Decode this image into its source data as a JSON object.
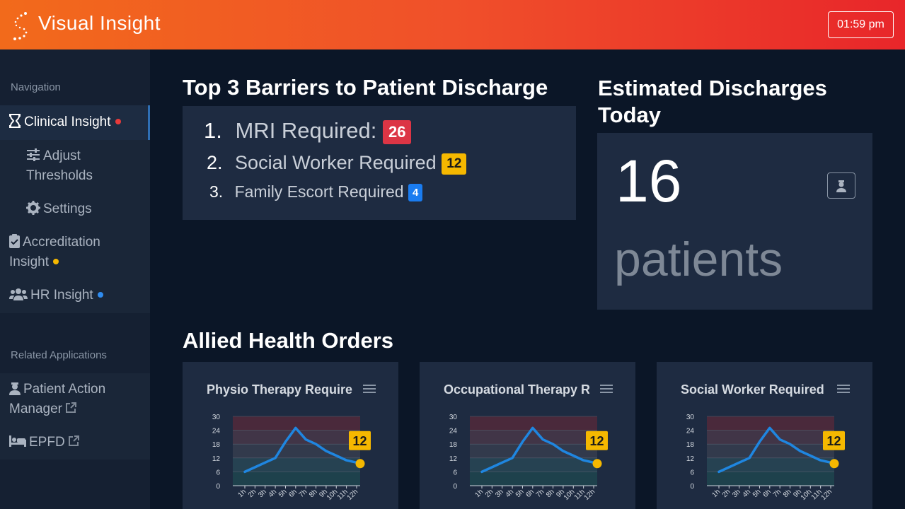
{
  "app": {
    "title": "Visual Insight",
    "time": "01:59 pm"
  },
  "sidebar": {
    "nav_heading": "Navigation",
    "items": [
      {
        "label": "Clinical Insight",
        "icon": "hourglass-icon",
        "dot": "#e83a3a"
      },
      {
        "label": "Adjust Thresholds",
        "icon": "sliders-icon"
      },
      {
        "label": "Settings",
        "icon": "gear-icon"
      },
      {
        "label": "Accreditation Insight",
        "icon": "clipboard-check-icon",
        "dot": "#f5b800"
      },
      {
        "label": "HR Insight",
        "icon": "users-icon",
        "dot": "#2f8cf0"
      }
    ],
    "related_heading": "Related Applications",
    "related": [
      {
        "label": "Patient Action Manager",
        "icon": "user-nurse-icon"
      },
      {
        "label": "EPFD",
        "icon": "bed-icon"
      }
    ]
  },
  "barriers": {
    "title": "Top 3 Barriers to Patient Discharge",
    "items": [
      {
        "rank": "1.",
        "label": "MRI Required:",
        "count": "26",
        "color": "#dc3545"
      },
      {
        "rank": "2.",
        "label": "Social Worker Required",
        "count": "12",
        "color": "#f5b800"
      },
      {
        "rank": "3.",
        "label": "Family Escort Required",
        "count": "4",
        "color": "#1a7cf0"
      }
    ]
  },
  "discharges": {
    "title": "Estimated Discharges Today",
    "value": "16",
    "unit": "patients"
  },
  "allied": {
    "title": "Allied Health Orders",
    "cards": [
      {
        "title": "Physio Therapy Required",
        "current": "12"
      },
      {
        "title": "Occupational Therapy Required",
        "current": "12"
      },
      {
        "title": "Social Worker Required",
        "current": "12"
      }
    ]
  },
  "chart_data": {
    "type": "line",
    "x": [
      "1h",
      "2h",
      "3h",
      "4h",
      "5h",
      "6h",
      "7h",
      "8h",
      "9h",
      "10h",
      "11h",
      "12h"
    ],
    "values": [
      6,
      8,
      10,
      12,
      19,
      25,
      20,
      18,
      15,
      13,
      11,
      10
    ],
    "current": 12,
    "yticks": [
      0,
      6,
      12,
      18,
      24,
      30
    ],
    "ylim": [
      0,
      30
    ],
    "bands": [
      {
        "from": 24,
        "to": 30,
        "color": "#5a2a3a"
      },
      {
        "from": 18,
        "to": 24,
        "color": "#4e3a4a"
      },
      {
        "from": 12,
        "to": 18,
        "color": "#3a4050"
      },
      {
        "from": 6,
        "to": 12,
        "color": "#2a4b58"
      },
      {
        "from": 0,
        "to": 6,
        "color": "#1f4a50"
      }
    ],
    "line_color": "#1f86e0",
    "marker_color": "#f5b800"
  }
}
